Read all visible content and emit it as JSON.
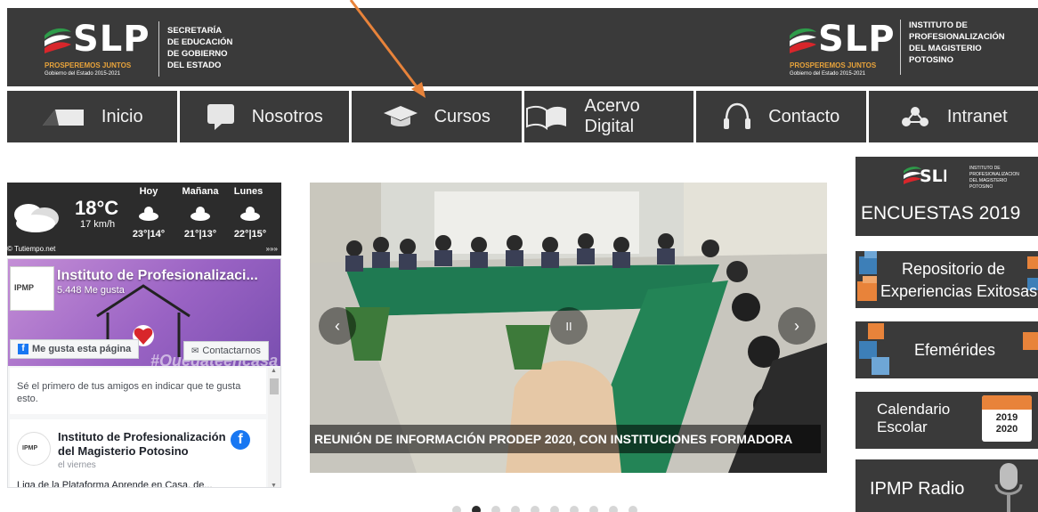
{
  "header": {
    "left_logo": {
      "mark": "SLP",
      "tagline": "PROSPEREMOS JUNTOS",
      "subtag": "Gobierno del Estado 2015-2021",
      "lines": [
        "SECRETARÍA",
        "DE EDUCACIÓN",
        "DE GOBIERNO",
        "DEL ESTADO"
      ]
    },
    "right_logo": {
      "mark": "SLP",
      "tagline": "PROSPEREMOS JUNTOS",
      "subtag": "Gobierno del Estado 2015-2021",
      "lines": [
        "INSTITUTO DE",
        "PROFESIONALIZACIÓN",
        "DEL MAGISTERIO",
        "POTOSINO"
      ]
    }
  },
  "nav": {
    "items": [
      {
        "label": "Inicio",
        "icon": "home-roof-icon"
      },
      {
        "label": "Nosotros",
        "icon": "speech-bubble-icon"
      },
      {
        "label": "Cursos",
        "icon": "graduation-cap-icon"
      },
      {
        "label": "Acervo Digital",
        "icon": "open-book-icon"
      },
      {
        "label": "Contacto",
        "icon": "headset-icon"
      },
      {
        "label": "Intranet",
        "icon": "network-icon"
      }
    ]
  },
  "weather": {
    "temp": "18°C",
    "wind": "17 km/h",
    "days": [
      {
        "day": "Hoy",
        "range": "23°|14°"
      },
      {
        "day": "Mañana",
        "range": "21°|13°"
      },
      {
        "day": "Lunes",
        "range": "22°|15°"
      }
    ],
    "credit": "© Tutiempo.net",
    "more": "»»»"
  },
  "facebook": {
    "page_name": "Instituto de Profesionalizaci...",
    "likes": "5.448 Me gusta",
    "like_button": "Me gusta esta página",
    "contact_button": "Contactarnos",
    "hashtag": "#Quedateencasa",
    "avatar_text": "IPMP",
    "first_friend": "Sé el primero de tus amigos en indicar que te gusta esto.",
    "post": {
      "author": "Instituto de Profesionalización del Magisterio Potosino",
      "date": "el viernes",
      "text": "Liga de la Plataforma Aprende en Casa, de..."
    }
  },
  "carousel": {
    "caption": "REUNIÓN DE INFORMACIÓN PRODEP 2020, CON INSTITUCIONES FORMADORA",
    "prev": "‹",
    "next": "›",
    "pause": "II",
    "slide_count": 10,
    "active_index": 1
  },
  "right_banners": {
    "encuestas": {
      "title": "ENCUESTAS 2019",
      "logo_lines": [
        "INSTITUTO DE",
        "PROFESIONALIZACION",
        "DEL MAGISTERIO",
        "POTOSINO"
      ]
    },
    "repositorio": {
      "line1": "Repositorio de",
      "line2": "Experiencias Exitosas"
    },
    "efemerides": {
      "title": "Efemérides"
    },
    "calendario": {
      "line1": "Calendario",
      "line2": "Escolar",
      "year1": "2019",
      "year2": "2020"
    },
    "radio": {
      "title": "IPMP Radio"
    }
  },
  "colors": {
    "header_bg": "#3a3a3a",
    "accent_orange": "#e8833a",
    "facebook_blue": "#1877f2"
  }
}
